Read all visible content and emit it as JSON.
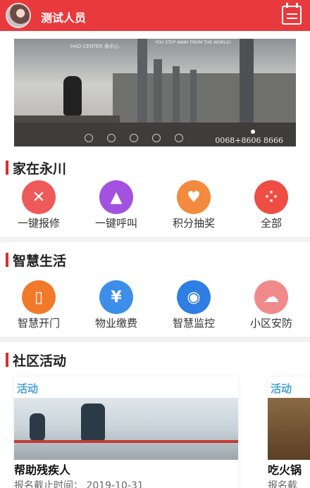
{
  "header": {
    "username": "测试人员",
    "calendar_icon": "calendar-icon",
    "bg_color": "#e8393c"
  },
  "banner": {
    "logo": "HAO CENTER 香中心",
    "tagline": "YOU STEP AWAY FROM THE WORLD!",
    "phone": "0068+8606 8666"
  },
  "section1": {
    "title": "家在永川",
    "items": [
      {
        "label": "一键报修",
        "icon": "wrench-icon",
        "color": "#ee5a5a"
      },
      {
        "label": "一键呼叫",
        "icon": "alarm-icon",
        "color": "#a351e0"
      },
      {
        "label": "积分抽奖",
        "icon": "heart-hand-icon",
        "color": "#f48a3d"
      },
      {
        "label": "全部",
        "icon": "grid-icon",
        "color": "#ee4d43"
      }
    ]
  },
  "section2": {
    "title": "智慧生活",
    "items": [
      {
        "label": "智慧开门",
        "icon": "door-icon",
        "color": "#f17a2a"
      },
      {
        "label": "物业缴费",
        "icon": "money-bag-icon",
        "color": "#3d8ee8"
      },
      {
        "label": "智慧监控",
        "icon": "camera-icon",
        "color": "#2f7ee3"
      },
      {
        "label": "小区安防",
        "icon": "cloud-shield-icon",
        "color": "#f08a8a"
      }
    ]
  },
  "section3": {
    "title": "社区活动",
    "cards": [
      {
        "tag": "活动",
        "title": "帮助残疾人",
        "meta": "报名截止时间： 2019-10-31"
      },
      {
        "tag": "活动",
        "title": "吃火锅",
        "meta": "报名截"
      }
    ]
  }
}
